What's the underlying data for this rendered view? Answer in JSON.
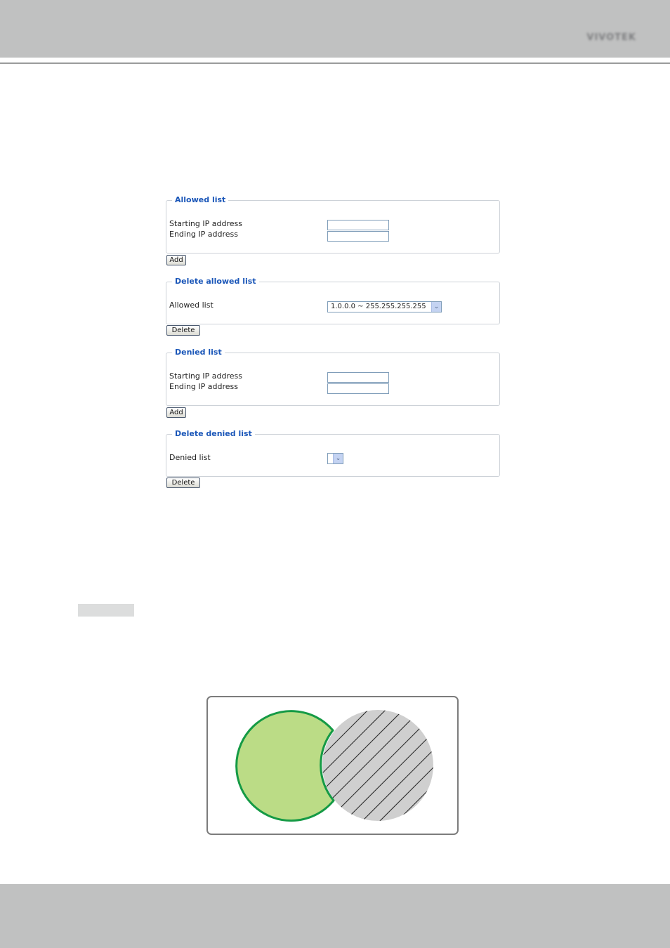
{
  "header": {
    "brand": "VIVOTEK"
  },
  "colors": {
    "band": "#c0c1c1",
    "legend_text": "#1a56b8",
    "allowed_fill": "#bbdc86",
    "allowed_stroke": "#159a45",
    "denied_fill": "#cfcfcf"
  },
  "allowed_list": {
    "legend": "Allowed list",
    "start_label": "Starting IP address",
    "end_label": "Ending IP address",
    "start_value": "",
    "end_value": "",
    "add_button": "Add"
  },
  "delete_allowed_list": {
    "legend": "Delete allowed list",
    "label": "Allowed list",
    "selected": "1.0.0.0 ~ 255.255.255.255",
    "delete_button": "Delete"
  },
  "denied_list": {
    "legend": "Denied list",
    "start_label": "Starting IP address",
    "end_label": "Ending IP address",
    "start_value": "",
    "end_value": "",
    "add_button": "Add"
  },
  "delete_denied_list": {
    "legend": "Delete denied list",
    "label": "Denied list",
    "selected": "",
    "delete_button": "Delete"
  },
  "icons": {
    "dropdown": "chevron-down-icon"
  }
}
